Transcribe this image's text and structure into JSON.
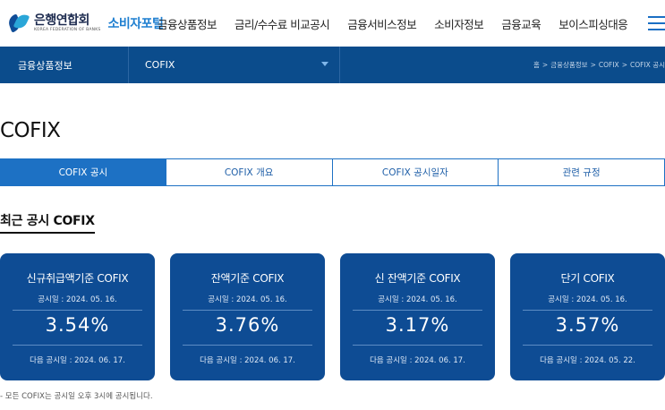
{
  "header": {
    "logo_main": "은행연합회",
    "logo_sub": "KOREA FEDERATION OF BANKS",
    "logo_portal": "소비자포털",
    "nav": [
      "금융상품정보",
      "금리/수수료 비교공시",
      "금융서비스정보",
      "소비자정보",
      "금융교육",
      "보이스피싱대응"
    ]
  },
  "location": {
    "depth1": "금융상품정보",
    "depth2": "COFIX",
    "breadcrumb": [
      "홈",
      "금융상품정보",
      "COFIX",
      "COFIX 공시"
    ]
  },
  "page_title": "COFIX",
  "tabs": [
    {
      "label": "COFIX 공시",
      "active": true
    },
    {
      "label": "COFIX 개요",
      "active": false
    },
    {
      "label": "COFIX 공시일자",
      "active": false
    },
    {
      "label": "관련 규정",
      "active": false
    }
  ],
  "section_title": "최근 공시 COFIX",
  "cards": [
    {
      "title": "신규취급액기준 COFIX",
      "date": "공시일 : 2024. 05. 16.",
      "rate": "3.54%",
      "next": "다음 공시일 : 2024. 06. 17."
    },
    {
      "title": "잔액기준 COFIX",
      "date": "공시일 : 2024. 05. 16.",
      "rate": "3.76%",
      "next": "다음 공시일 : 2024. 06. 17."
    },
    {
      "title": "신 잔액기준 COFIX",
      "date": "공시일 : 2024. 05. 16.",
      "rate": "3.17%",
      "next": "다음 공시일 : 2024. 06. 17."
    },
    {
      "title": "단기 COFIX",
      "date": "공시일 : 2024. 05. 16.",
      "rate": "3.57%",
      "next": "다음 공시일 : 2024. 05. 22."
    }
  ],
  "footnote": "- 모든 COFIX는 공시일 오후 3시에 공시됩니다.",
  "colors": {
    "brand_navy": "#0b4c8c",
    "card_blue": "#0e4c94",
    "tab_blue": "#1d71c4",
    "portal_blue": "#1f7fd0"
  }
}
